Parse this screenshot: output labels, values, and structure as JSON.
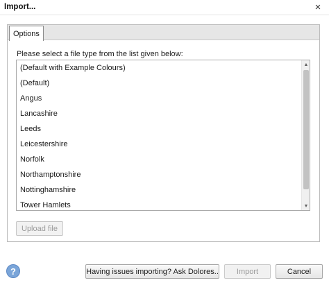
{
  "window": {
    "title": "Import...",
    "close_glyph": "×"
  },
  "tabs": [
    {
      "label": "Options",
      "selected": true
    }
  ],
  "instruction": "Please select a file type from the list given below:",
  "file_types": [
    "(Default with Example Colours)",
    "(Default)",
    "Angus",
    "Lancashire",
    "Leeds",
    "Leicestershire",
    "Norfolk",
    "Northamptonshire",
    "Nottinghamshire",
    "Tower Hamlets"
  ],
  "scrollbar": {
    "up_glyph": "▲",
    "down_glyph": "▼"
  },
  "upload_button": {
    "label": "Upload file",
    "enabled": false
  },
  "footer": {
    "help_glyph": "?",
    "ask_label": "Having issues importing? Ask Dolores..",
    "import_label": "Import",
    "import_enabled": false,
    "cancel_label": "Cancel"
  }
}
